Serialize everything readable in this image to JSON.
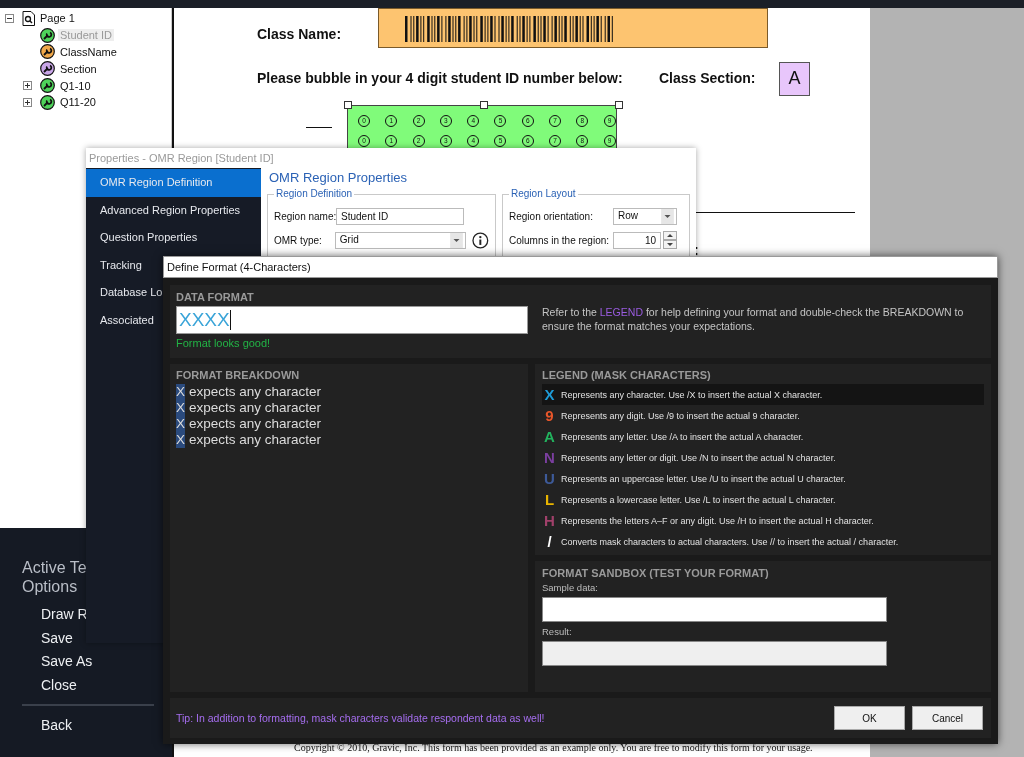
{
  "tree": {
    "root": {
      "label": "Page 1",
      "expanded": true,
      "children": [
        {
          "label": "Student ID",
          "color": "#4fd35a",
          "selected": true
        },
        {
          "label": "ClassName",
          "color": "#f0a84a",
          "selected": false
        },
        {
          "label": "Section",
          "color": "#c9a6e8",
          "selected": false
        },
        {
          "label": "Q1-10",
          "color": "#4fd35a",
          "selected": false,
          "expanded": false
        },
        {
          "label": "Q11-20",
          "color": "#4fd35a",
          "selected": false,
          "expanded": false
        }
      ]
    }
  },
  "document": {
    "class_name_label": "Class Name:",
    "instruction": "Please bubble in your 4 digit student ID number below:",
    "class_section_label": "Class Section:",
    "class_section_value": "A",
    "bubble_rows": [
      [
        "0",
        "1",
        "2",
        "3",
        "4",
        "5",
        "6",
        "7",
        "8",
        "9"
      ],
      [
        "0",
        "1",
        "2",
        "3",
        "4",
        "5",
        "6",
        "7",
        "8",
        "9"
      ]
    ],
    "colon": ":",
    "footer": "Copyright © 2010, Gravic, Inc. This form has been provided as an example only. You are free to modify this form for your usage."
  },
  "side_menu": {
    "heading": "Active Te\nOptions",
    "items": [
      "Draw R",
      "Save",
      "Save As",
      "Close"
    ],
    "back": "Back"
  },
  "properties": {
    "title": "Properties - OMR Region [Student ID]",
    "nav": [
      {
        "label": "OMR Region Definition",
        "selected": true
      },
      {
        "label": "Advanced Region Properties",
        "selected": false
      },
      {
        "label": "Question Properties",
        "selected": false
      },
      {
        "label": "Tracking",
        "selected": false
      },
      {
        "label": "Database Lo",
        "selected": false
      },
      {
        "label": "Associated",
        "selected": false
      }
    ],
    "heading": "OMR Region Properties",
    "groups": [
      {
        "title": "Region Definition",
        "fields": [
          {
            "kind": "text",
            "label": "Region name:",
            "value": "Student ID"
          },
          {
            "kind": "select",
            "label": "OMR type:",
            "value": "Grid",
            "info": true
          }
        ]
      },
      {
        "title": "Region Layout",
        "fields": [
          {
            "kind": "select",
            "label": "Region orientation:",
            "value": "Row"
          },
          {
            "kind": "spin",
            "label": "Columns in the region:",
            "value": "10"
          }
        ]
      }
    ]
  },
  "define_format": {
    "title": "Define Format (4-Characters)",
    "data_format": {
      "label": "DATA FORMAT",
      "value": "XXXX",
      "status": "Format looks good!"
    },
    "help": "Refer to the **LEGEND** for help defining your format and double-check the BREAKDOWN to ensure the format matches your expectations.",
    "breakdown": {
      "title": "FORMAT BREAKDOWN",
      "rows": [
        {
          "mask": "X",
          "text": "expects any character"
        },
        {
          "mask": "X",
          "text": "expects any character"
        },
        {
          "mask": "X",
          "text": "expects any character"
        },
        {
          "mask": "X",
          "text": "expects any character"
        }
      ]
    },
    "legend": {
      "title": "LEGEND (MASK CHARACTERS)",
      "rows": [
        {
          "mask": "X",
          "color": "#1e9bd7",
          "text": "Represents any character. Use /X to insert the actual X character.",
          "selected": true
        },
        {
          "mask": "9",
          "color": "#e8562a",
          "text": "Represents any digit. Use /9 to insert the actual 9 character.",
          "selected": false
        },
        {
          "mask": "A",
          "color": "#22b35e",
          "text": "Represents any letter. Use /A to insert the actual A character.",
          "selected": false
        },
        {
          "mask": "N",
          "color": "#7b3fa0",
          "text": "Represents any letter or digit. Use /N to insert the actual N character.",
          "selected": false
        },
        {
          "mask": "U",
          "color": "#3d5a99",
          "text": "Represents an uppercase letter. Use /U to insert the actual U character.",
          "selected": false
        },
        {
          "mask": "L",
          "color": "#e8b400",
          "text": "Represents a lowercase letter. Use /L to insert the actual L character.",
          "selected": false
        },
        {
          "mask": "H",
          "color": "#a0406a",
          "text": "Represents the letters A–F or any digit. Use /H to insert the actual H character.",
          "selected": false
        },
        {
          "mask": "/",
          "color": "#ffffff",
          "text": "Converts mask characters to actual characters. Use // to insert the actual / character.",
          "selected": false
        }
      ]
    },
    "sandbox": {
      "title": "FORMAT SANDBOX (TEST YOUR FORMAT)",
      "sample_label": "Sample data:",
      "result_label": "Result:"
    },
    "tip": "Tip: In addition to formatting, mask characters validate respondent data as well!",
    "buttons": [
      "OK",
      "Cancel"
    ]
  }
}
